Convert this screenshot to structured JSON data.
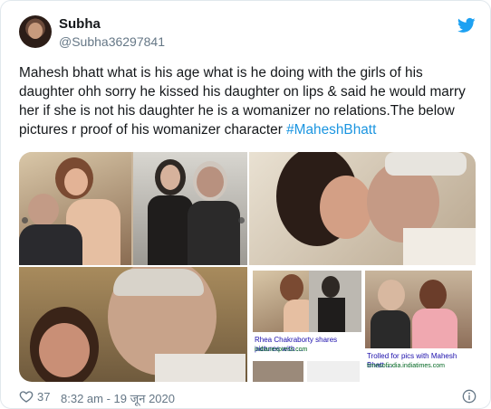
{
  "user": {
    "name": "Subha",
    "handle": "@Subha36297841"
  },
  "tweet": {
    "text": "Mahesh bhatt what is his age what is he doing with the girls of his daughter ohh sorry he kissed his daughter on lips & said he would marry her if she is not his daughter he is a womanizer no relations.The below pictures r proof of his womanizer character ",
    "hashtag": "#MaheshBhatt"
  },
  "media": {
    "search_results": [
      {
        "caption": "Rhea Chakraborty shares pictures with ...",
        "source": "indianexpress.com"
      },
      {
        "caption": "Trolled for pics with Mahesh Bhatt ...",
        "source": "timesofindia.indiatimes.com"
      }
    ]
  },
  "footer": {
    "likes": "37",
    "timestamp": "8:32 am - 19 जून 2020"
  },
  "colors": {
    "accent": "#1da1f2",
    "hashtag": "#1b95e0",
    "muted": "#657786"
  }
}
